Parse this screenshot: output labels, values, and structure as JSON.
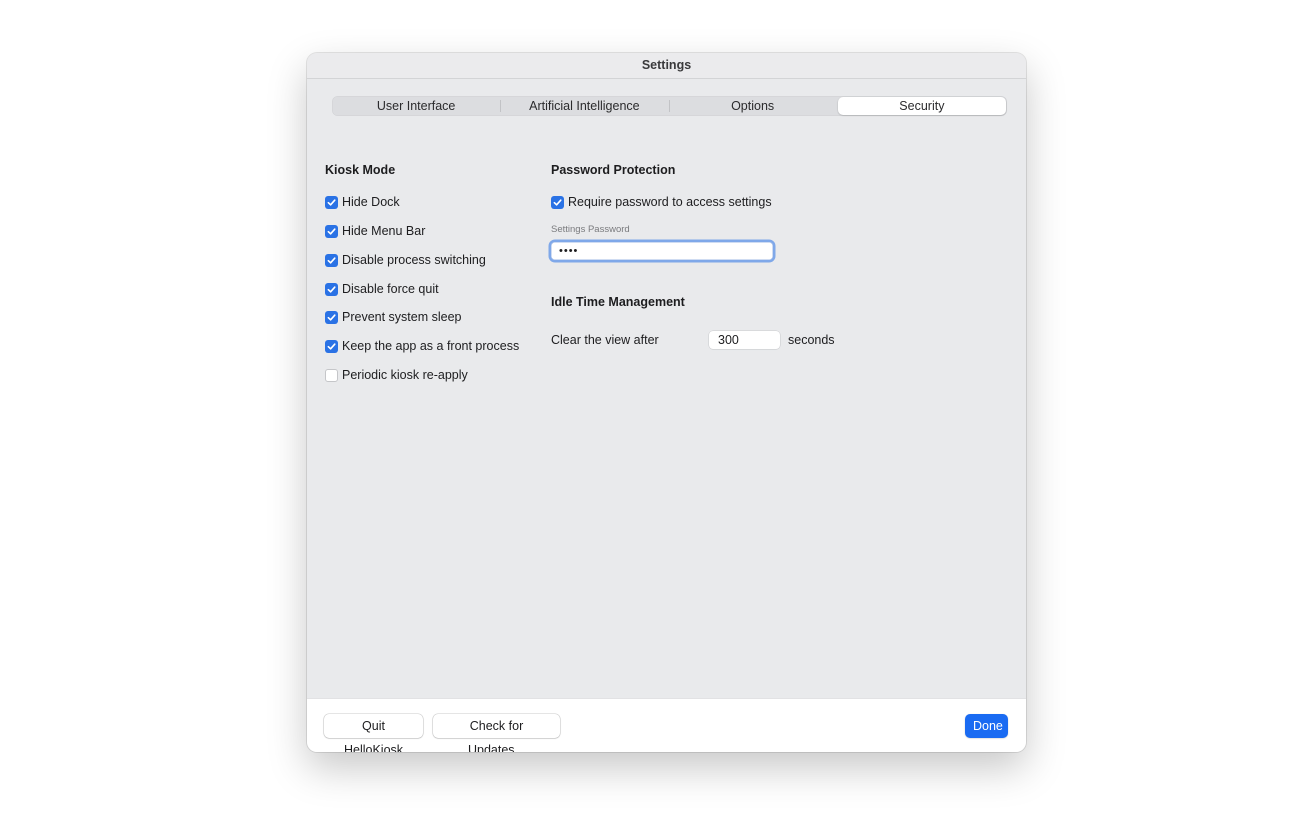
{
  "window": {
    "title": "Settings"
  },
  "tabs": [
    {
      "label": "User Interface",
      "active": false
    },
    {
      "label": "Artificial Intelligence",
      "active": false
    },
    {
      "label": "Options",
      "active": false
    },
    {
      "label": "Security",
      "active": true
    }
  ],
  "kiosk_mode": {
    "title": "Kiosk Mode",
    "items": [
      {
        "label": "Hide Dock",
        "checked": true
      },
      {
        "label": "Hide Menu Bar",
        "checked": true
      },
      {
        "label": "Disable process switching",
        "checked": true
      },
      {
        "label": "Disable force quit",
        "checked": true
      },
      {
        "label": "Prevent system sleep",
        "checked": true
      },
      {
        "label": "Keep the app as a front process",
        "checked": true
      },
      {
        "label": "Periodic kiosk re-apply",
        "checked": false
      }
    ]
  },
  "password_protection": {
    "title": "Password Protection",
    "require_label": "Require password to access settings",
    "require_checked": true,
    "field_label": "Settings Password",
    "field_value": "••••"
  },
  "idle_time": {
    "title": "Idle Time Management",
    "clear_label": "Clear the view after",
    "value": "300",
    "unit": "seconds"
  },
  "footer": {
    "quit_label": "Quit HelloKiosk",
    "updates_label": "Check for Updates...",
    "done_label": "Done"
  },
  "colors": {
    "accent": "#1a6bf2",
    "checkbox_on": "#2a72e5",
    "window_bg": "#e9eaec"
  }
}
